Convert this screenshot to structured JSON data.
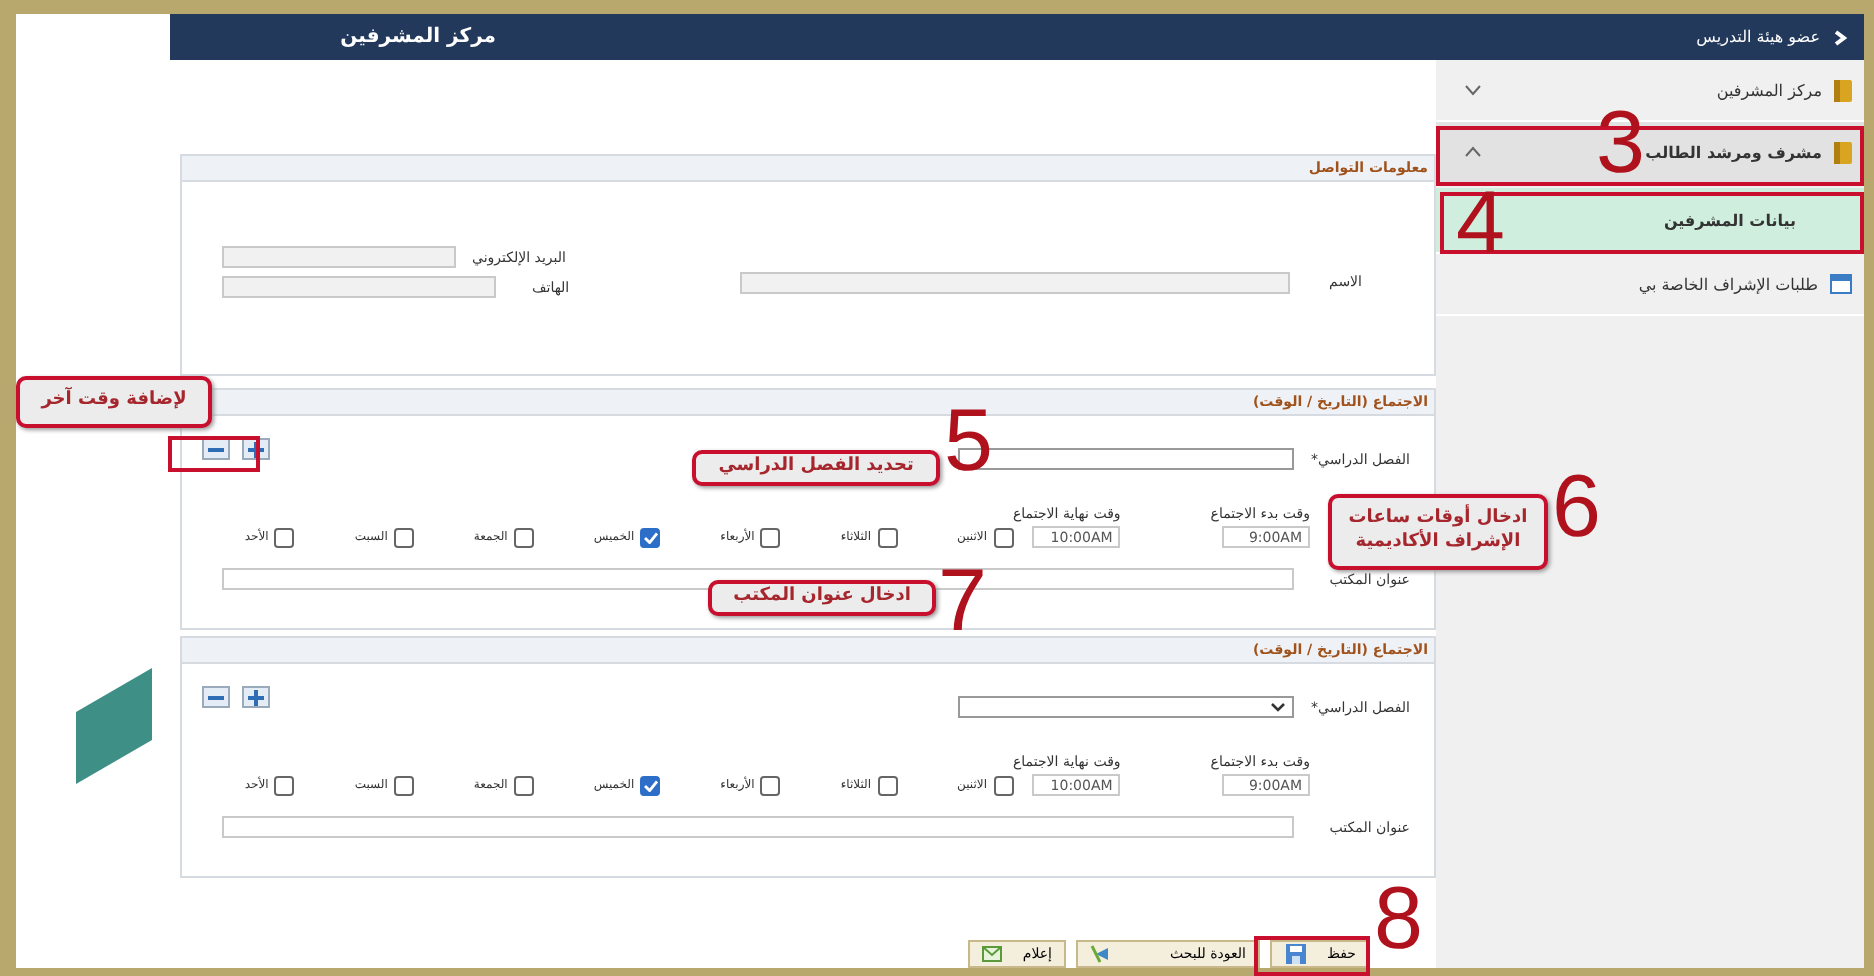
{
  "header": {
    "title": "مركز المشرفين",
    "back_label": "عضو هيئة التدريس"
  },
  "sidebar": {
    "items": [
      {
        "label": "مركز المشرفين",
        "kind": "folder",
        "expanded": false,
        "selected": false
      },
      {
        "label": "مشرف ومرشد الطالب",
        "kind": "folder",
        "expanded": true,
        "selected": false,
        "children": [
          {
            "label": "بيانات المشرفين",
            "selected": true
          }
        ]
      },
      {
        "label": "طلبات الإشراف الخاصة بي",
        "kind": "page",
        "selected": false
      }
    ]
  },
  "contact": {
    "title": "معلومات التواصل",
    "fields": [
      {
        "label": "الاسم"
      },
      {
        "label": "البريد الإلكتروني"
      },
      {
        "label": "الهاتف"
      }
    ]
  },
  "meetings": [
    {
      "title": "الاجتماع (التاريخ / الوقت)",
      "term": {
        "label": "الفصل الدراسي*",
        "kind": "text"
      },
      "start": {
        "label": "وقت بدء الاجتماع",
        "value": "9:00AM"
      },
      "end": {
        "label": "وقت نهاية الاجتماع",
        "value": "10:00AM"
      },
      "days": [
        {
          "label": "الاثنين",
          "checked": false
        },
        {
          "label": "الثلاثاء",
          "checked": false
        },
        {
          "label": "الأربعاء",
          "checked": false
        },
        {
          "label": "الخميس",
          "checked": true
        },
        {
          "label": "الجمعة",
          "checked": false
        },
        {
          "label": "السبت",
          "checked": false
        },
        {
          "label": "الأحد",
          "checked": false
        }
      ],
      "office": {
        "label": "عنوان المكتب"
      }
    },
    {
      "title": "الاجتماع (التاريخ / الوقت)",
      "term": {
        "label": "الفصل الدراسي*",
        "kind": "select"
      },
      "start": {
        "label": "وقت بدء الاجتماع",
        "value": "9:00AM"
      },
      "end": {
        "label": "وقت نهاية الاجتماع",
        "value": "10:00AM"
      },
      "days": [
        {
          "label": "الاثنين",
          "checked": false
        },
        {
          "label": "الثلاثاء",
          "checked": false
        },
        {
          "label": "الأربعاء",
          "checked": false
        },
        {
          "label": "الخميس",
          "checked": true
        },
        {
          "label": "الجمعة",
          "checked": false
        },
        {
          "label": "السبت",
          "checked": false
        },
        {
          "label": "الأحد",
          "checked": false
        }
      ],
      "office": {
        "label": "عنوان المكتب"
      }
    }
  ],
  "buttons": [
    {
      "label": "حفظ",
      "kind": "save"
    },
    {
      "label": "العودة للبحث",
      "kind": "back"
    },
    {
      "label": "إعلام",
      "kind": "notify"
    }
  ],
  "annotations": {
    "numbers": [
      "3",
      "4",
      "5",
      "6",
      "7",
      "8"
    ],
    "callouts": [
      "لإضافة وقت آخر",
      "تحديد الفصل الدراسي",
      "ادخال أوقات ساعات الإشراف الأكاديمية",
      "ادخال عنوان المكتب"
    ]
  }
}
